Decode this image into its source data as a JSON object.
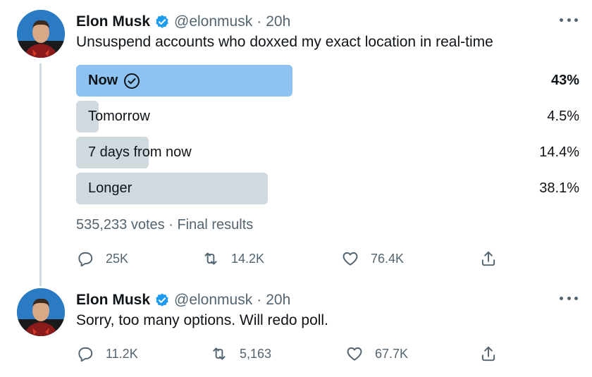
{
  "tweets": [
    {
      "author": {
        "name": "Elon Musk",
        "handle": "@elonmusk",
        "time": "20h"
      },
      "text": "Unsuspend accounts who doxxed my exact location in real-time",
      "poll": {
        "options": [
          {
            "label": "Now",
            "percent": "43%",
            "fraction": 0.43,
            "winner": true
          },
          {
            "label": "Tomorrow",
            "percent": "4.5%",
            "fraction": 0.045,
            "winner": false
          },
          {
            "label": "7 days from now",
            "percent": "14.4%",
            "fraction": 0.144,
            "winner": false
          },
          {
            "label": "Longer",
            "percent": "38.1%",
            "fraction": 0.381,
            "winner": false
          }
        ],
        "votes": "535,233 votes",
        "status": "Final results"
      },
      "stats": {
        "replies": "25K",
        "retweets": "14.2K",
        "likes": "76.4K"
      }
    },
    {
      "author": {
        "name": "Elon Musk",
        "handle": "@elonmusk",
        "time": "20h"
      },
      "text": "Sorry, too many options. Will redo poll.",
      "stats": {
        "replies": "11.2K",
        "retweets": "5,163",
        "likes": "67.7K"
      }
    }
  ],
  "ui": {
    "separator": "·"
  },
  "colors": {
    "winner_bar": "#8ec3f1",
    "bar": "#cfd9de",
    "verified": "#1d9bf0",
    "muted_text": "#536471"
  },
  "icons": [
    "verified-badge-icon",
    "more-icon",
    "check-circle-icon",
    "reply-icon",
    "retweet-icon",
    "like-icon",
    "share-icon"
  ]
}
